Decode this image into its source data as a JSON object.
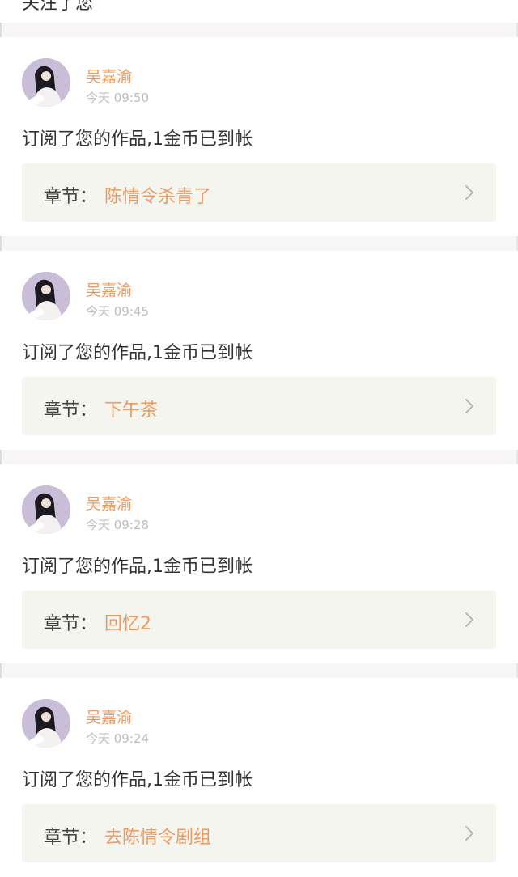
{
  "top_card": {
    "text": "关注了您"
  },
  "notifications": [
    {
      "username": "吴嘉渝",
      "time": "今天 09:50",
      "message": "订阅了您的作品,1金币已到帐",
      "chapter_label": "章节：",
      "chapter_title": "陈情令杀青了"
    },
    {
      "username": "吴嘉渝",
      "time": "今天 09:45",
      "message": "订阅了您的作品,1金币已到帐",
      "chapter_label": "章节：",
      "chapter_title": "下午茶"
    },
    {
      "username": "吴嘉渝",
      "time": "今天 09:28",
      "message": "订阅了您的作品,1金币已到帐",
      "chapter_label": "章节：",
      "chapter_title": "回忆2"
    },
    {
      "username": "吴嘉渝",
      "time": "今天 09:24",
      "message": "订阅了您的作品,1金币已到帐",
      "chapter_label": "章节：",
      "chapter_title": "去陈情令剧组"
    }
  ],
  "colors": {
    "accent": "#eb9a62",
    "background": "#f7f5f5",
    "card": "#ffffff",
    "chapter_box": "#f5f5f0"
  }
}
